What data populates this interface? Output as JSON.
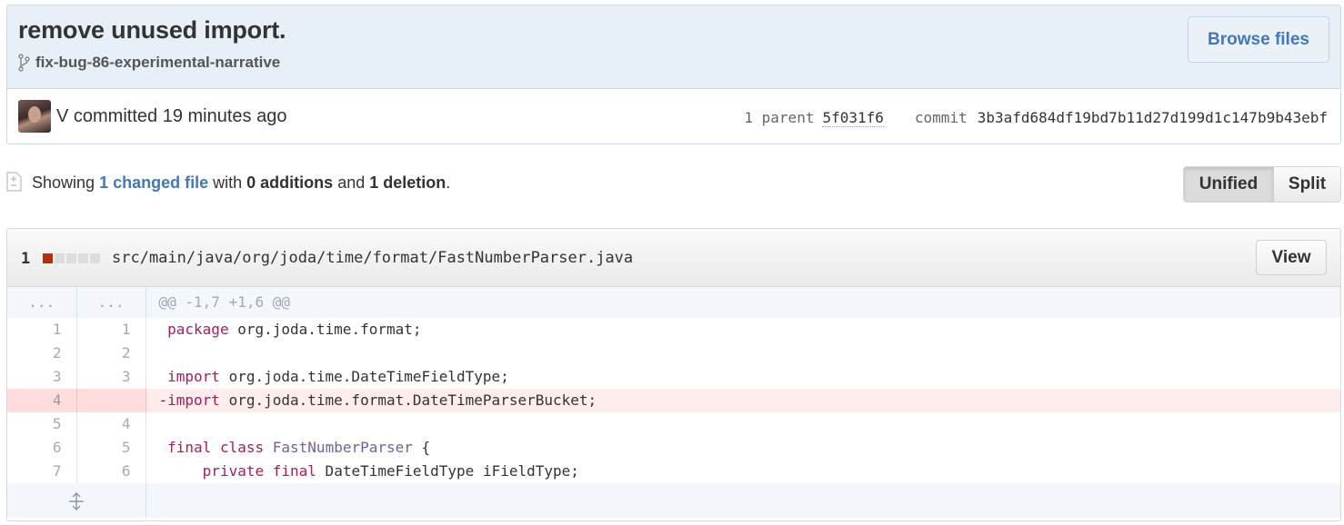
{
  "commit": {
    "title": "remove unused import.",
    "branch": "fix-bug-86-experimental-narrative",
    "browse_label": "Browse files",
    "author_line": "V committed 19 minutes ago",
    "parent_label": "1 parent",
    "parent_sha": "5f031f6",
    "commit_label": "commit",
    "commit_sha": "3b3afd684df19bd7b11d27d199d1c147b9b43ebf"
  },
  "toc": {
    "showing": "Showing",
    "changed_files": "1 changed file",
    "with": "with",
    "additions": "0 additions",
    "and": "and",
    "deletions": "1 deletion",
    "period": ".",
    "view_modes": {
      "unified": "Unified",
      "split": "Split"
    },
    "selected_mode": "Unified"
  },
  "file": {
    "change_count": "1",
    "diffstat": {
      "deletions": 1,
      "neutral": 4
    },
    "path": "src/main/java/org/joda/time/format/FastNumberParser.java",
    "view_label": "View",
    "hunk_ellipsis": "...",
    "hunk_header": "@@ -1,7 +1,6 @@",
    "lines": [
      {
        "old": "1",
        "new": "1",
        "type": "ctx",
        "code": " package org.joda.time.format;"
      },
      {
        "old": "2",
        "new": "2",
        "type": "ctx",
        "code": " "
      },
      {
        "old": "3",
        "new": "3",
        "type": "ctx",
        "code": " import org.joda.time.DateTimeFieldType;"
      },
      {
        "old": "4",
        "new": "",
        "type": "del",
        "code": "-import org.joda.time.format.DateTimeParserBucket;"
      },
      {
        "old": "5",
        "new": "4",
        "type": "ctx",
        "code": " "
      },
      {
        "old": "6",
        "new": "5",
        "type": "ctx",
        "code": " final class FastNumberParser {"
      },
      {
        "old": "7",
        "new": "6",
        "type": "ctx",
        "code": "     private final DateTimeFieldType iFieldType;"
      }
    ]
  },
  "colors": {
    "accent": "#4078c0",
    "deletion": "#bd2c00",
    "deletion_bg": "#ffecec",
    "keyword": "#a71d5d",
    "class_name": "#795da3"
  }
}
